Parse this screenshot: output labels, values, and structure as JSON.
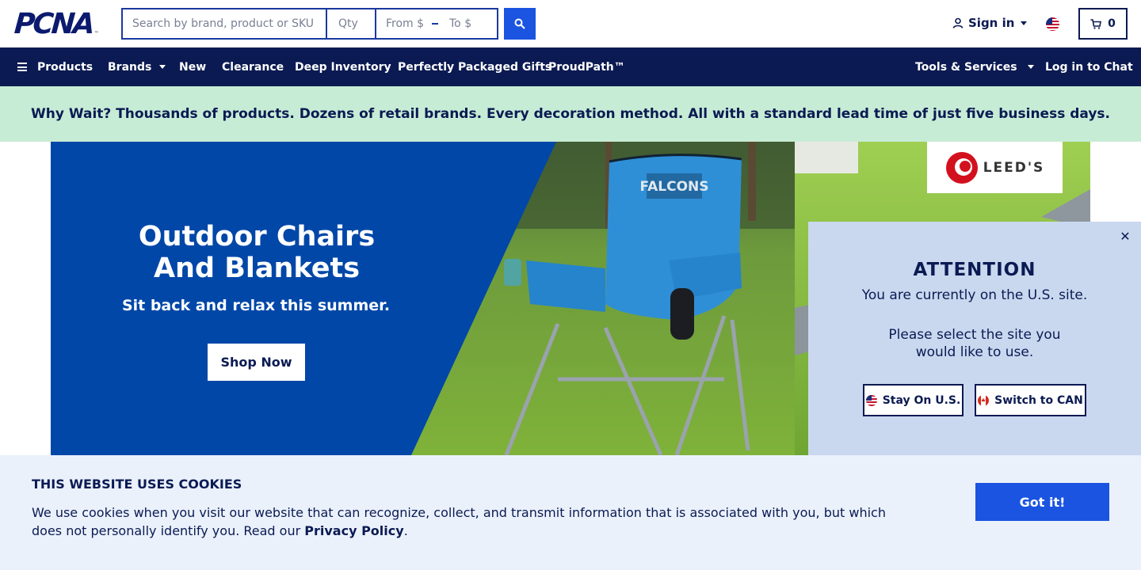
{
  "header": {
    "logo_text": "PCNA",
    "logo_tm": "™",
    "search_placeholder": "Search by brand, product or SKU",
    "qty_placeholder": "Qty",
    "price_from_placeholder": "From $",
    "price_to_placeholder": "To $",
    "signin_label": "Sign in",
    "cart_count": "0"
  },
  "nav": {
    "items": [
      {
        "label": "Products"
      },
      {
        "label": "Brands"
      },
      {
        "label": "New"
      },
      {
        "label": "Clearance"
      },
      {
        "label": "Deep Inventory"
      },
      {
        "label": "Perfectly Packaged Gifts"
      },
      {
        "label": "ProudPath™"
      },
      {
        "label": "Tools & Services"
      },
      {
        "label": "Log in to Chat"
      }
    ]
  },
  "promo": {
    "text": "Why Wait? Thousands of products. Dozens of retail brands. Every decoration method. All with a standard lead time of just five business days."
  },
  "hero": {
    "title_line1": "Outdoor Chairs",
    "title_line2": "And Blankets",
    "subtitle": "Sit back and relax this summer.",
    "cta": "Shop Now",
    "brand_logo": "LEED'S",
    "chair_print": "FALCONS"
  },
  "attention": {
    "title": "ATTENTION",
    "line1": "You are currently on the U.S. site.",
    "line2": "Please select the site you would like to use.",
    "stay_label": "Stay On U.S.",
    "switch_label": "Switch to CAN",
    "close_glyph": "✕"
  },
  "cookies": {
    "title": "THIS WEBSITE USES COOKIES",
    "text": "We use cookies when you visit our website that can recognize, collect, and transmit information that is associated with you, but which does not personally identify you. Read our ",
    "link": "Privacy Policy",
    "end": ".",
    "button": "Got it!"
  },
  "colors": {
    "navy": "#0b1a52",
    "accent_blue": "#1a54e0",
    "promo_bg": "#c7ecd6",
    "hero_blue": "#0047a8",
    "modal_bg": "#c9d8ef",
    "cookie_bg": "#eaf1fb"
  }
}
